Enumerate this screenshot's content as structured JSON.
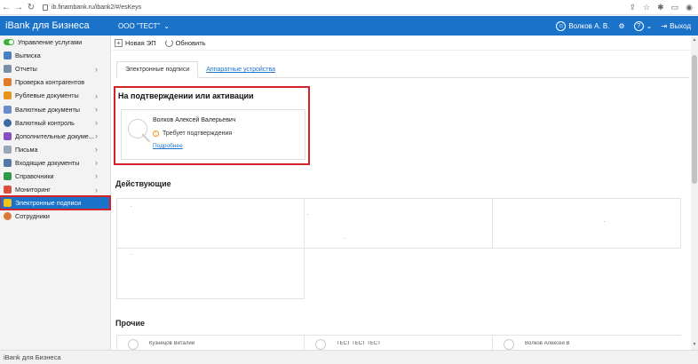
{
  "browser": {
    "url": "ib.finambank.ru/ibank2/#/esKeys"
  },
  "header": {
    "brand": "iBank для Бизнеса",
    "org": "ООО \"ТЕСТ\"",
    "user": "Волков А. В.",
    "logout": "Выход",
    "accent": "#1a73c9"
  },
  "sidebar": {
    "items": [
      {
        "label": "Управление услугами",
        "icon": "toggle-icon",
        "chevron": false
      },
      {
        "label": "Выписка",
        "icon": "document-icon",
        "chevron": false
      },
      {
        "label": "Отчеты",
        "icon": "report-icon",
        "chevron": true
      },
      {
        "label": "Проверка контрагентов",
        "icon": "check-icon",
        "chevron": false
      },
      {
        "label": "Рублевые документы",
        "icon": "ruble-icon",
        "chevron": true
      },
      {
        "label": "Валютные документы",
        "icon": "currency-icon",
        "chevron": true
      },
      {
        "label": "Валютный контроль",
        "icon": "control-icon",
        "chevron": true
      },
      {
        "label": "Дополнительные докуме...",
        "icon": "plus-docs-icon",
        "chevron": true
      },
      {
        "label": "Письма",
        "icon": "mail-icon",
        "chevron": true
      },
      {
        "label": "Входящие документы",
        "icon": "inbox-icon",
        "chevron": true
      },
      {
        "label": "Справочники",
        "icon": "book-icon",
        "chevron": true
      },
      {
        "label": "Мониторинг",
        "icon": "monitor-icon",
        "chevron": true
      },
      {
        "label": "Электронные подписи",
        "icon": "key-icon",
        "chevron": false,
        "active": true
      },
      {
        "label": "Сотрудники",
        "icon": "people-icon",
        "chevron": false
      }
    ]
  },
  "toolbar": {
    "new_label": "Новая ЭП",
    "refresh_label": "Обновить"
  },
  "tabs": [
    {
      "label": "Электронные подписи"
    },
    {
      "label": "Аппаратные устройства"
    }
  ],
  "pending": {
    "title": "На подтверждении или активации",
    "name": "Волков Алексей Валерьевич",
    "status": "Требует подтверждения",
    "more": "Подробнее"
  },
  "active": {
    "title": "Действующие"
  },
  "other": {
    "title": "Прочие",
    "items": [
      {
        "label": "Кузнецов Виталий"
      },
      {
        "label": "ТЕСТ ТЕСТ ТЕСТ"
      },
      {
        "label": "Волков Алексей В"
      }
    ]
  },
  "footer": {
    "label": "iBank для Бизнеса"
  }
}
